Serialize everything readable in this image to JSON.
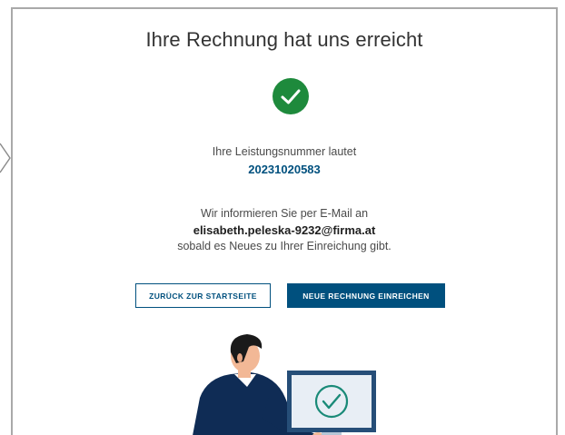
{
  "page": {
    "title": "Ihre Rechnung hat uns erreicht",
    "service_number_label": "Ihre Leistungsnummer lautet",
    "service_number": "20231020583",
    "inform_text": "Wir informieren Sie per E-Mail an",
    "email": "elisabeth.peleska-9232@firma.at",
    "update_text": "sobald es Neues zu Ihrer Einreichung gibt."
  },
  "buttons": {
    "back_label": "ZURÜCK ZUR STARTSEITE",
    "new_invoice_label": "NEUE RECHNUNG EINREICHEN"
  },
  "colors": {
    "success_green": "#1e8a3c",
    "brand_blue": "#00507e",
    "border_gray": "#a9a9a9"
  },
  "icons": {
    "success": "check-circle-icon",
    "nav": "chevron-left-icon"
  }
}
